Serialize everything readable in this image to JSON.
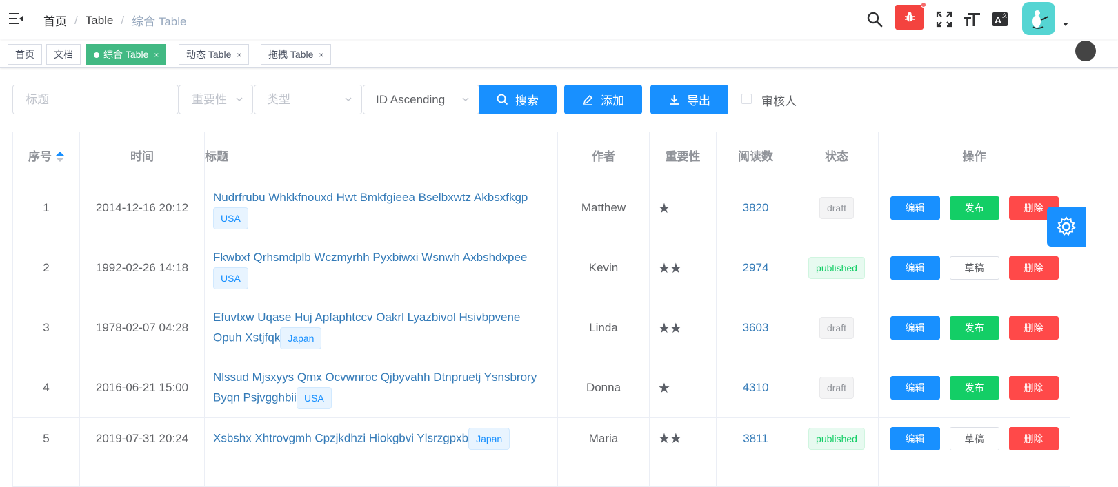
{
  "breadcrumb": [
    "首页",
    "Table",
    "综合 Table"
  ],
  "tags": [
    {
      "label": "首页",
      "active": false,
      "closable": false
    },
    {
      "label": "文档",
      "active": false,
      "closable": false
    },
    {
      "label": "综合 Table",
      "active": true,
      "closable": true
    },
    {
      "label": "动态 Table",
      "active": false,
      "closable": true
    },
    {
      "label": "拖拽 Table",
      "active": false,
      "closable": true
    }
  ],
  "filters": {
    "title_placeholder": "标题",
    "importance_placeholder": "重要性",
    "type_placeholder": "类型",
    "sort_value": "ID Ascending",
    "search_label": "搜索",
    "add_label": "添加",
    "export_label": "导出",
    "reviewer_label": "审核人"
  },
  "table": {
    "columns": [
      "序号",
      "时间",
      "标题",
      "作者",
      "重要性",
      "阅读数",
      "状态",
      "操作"
    ],
    "action_labels": {
      "edit": "编辑",
      "publish": "发布",
      "draft": "草稿",
      "delete": "删除"
    },
    "rows": [
      {
        "id": "1",
        "time": "2014-12-16 20:12",
        "title": "Nudrfrubu Whkkfnouxd Hwt Bmkfgieea Bselbxwtz Akbsxfkgp",
        "tag": "USA",
        "author": "Matthew",
        "importance": 1,
        "reads": "3820",
        "status": "draft"
      },
      {
        "id": "2",
        "time": "1992-02-26 14:18",
        "title": "Fkwbxf Qrhsmdplb Wczmyrhh Pyxbiwxi Wsnwh Axbshdxpee",
        "tag": "USA",
        "author": "Kevin",
        "importance": 2,
        "reads": "2974",
        "status": "published"
      },
      {
        "id": "3",
        "time": "1978-02-07 04:28",
        "title": "Efuvtxw Uqase Huj Apfaphtccv Oakrl Lyazbivol Hsivbpvene Opuh Xstjfqk",
        "tag": "Japan",
        "author": "Linda",
        "importance": 2,
        "reads": "3603",
        "status": "draft"
      },
      {
        "id": "4",
        "time": "2016-06-21 15:00",
        "title": "Nlssud Mjsxyys Qmx Ocvwnroc Qjbyvahh Dtnpruetj Ysnsbrory Byqn Psjvgghbii",
        "tag": "USA",
        "author": "Donna",
        "importance": 1,
        "reads": "4310",
        "status": "draft"
      },
      {
        "id": "5",
        "time": "2019-07-31 20:24",
        "title": "Xsbshx Xhtrovgmh Cpzjkdhzi Hiokgbvi Ylsrzgpxb",
        "tag": "Japan",
        "author": "Maria",
        "importance": 2,
        "reads": "3811",
        "status": "published"
      }
    ]
  },
  "colors": {
    "primary": "#1890ff",
    "success": "#13ce66",
    "danger": "#ff4949",
    "active_tag": "#42b983"
  }
}
